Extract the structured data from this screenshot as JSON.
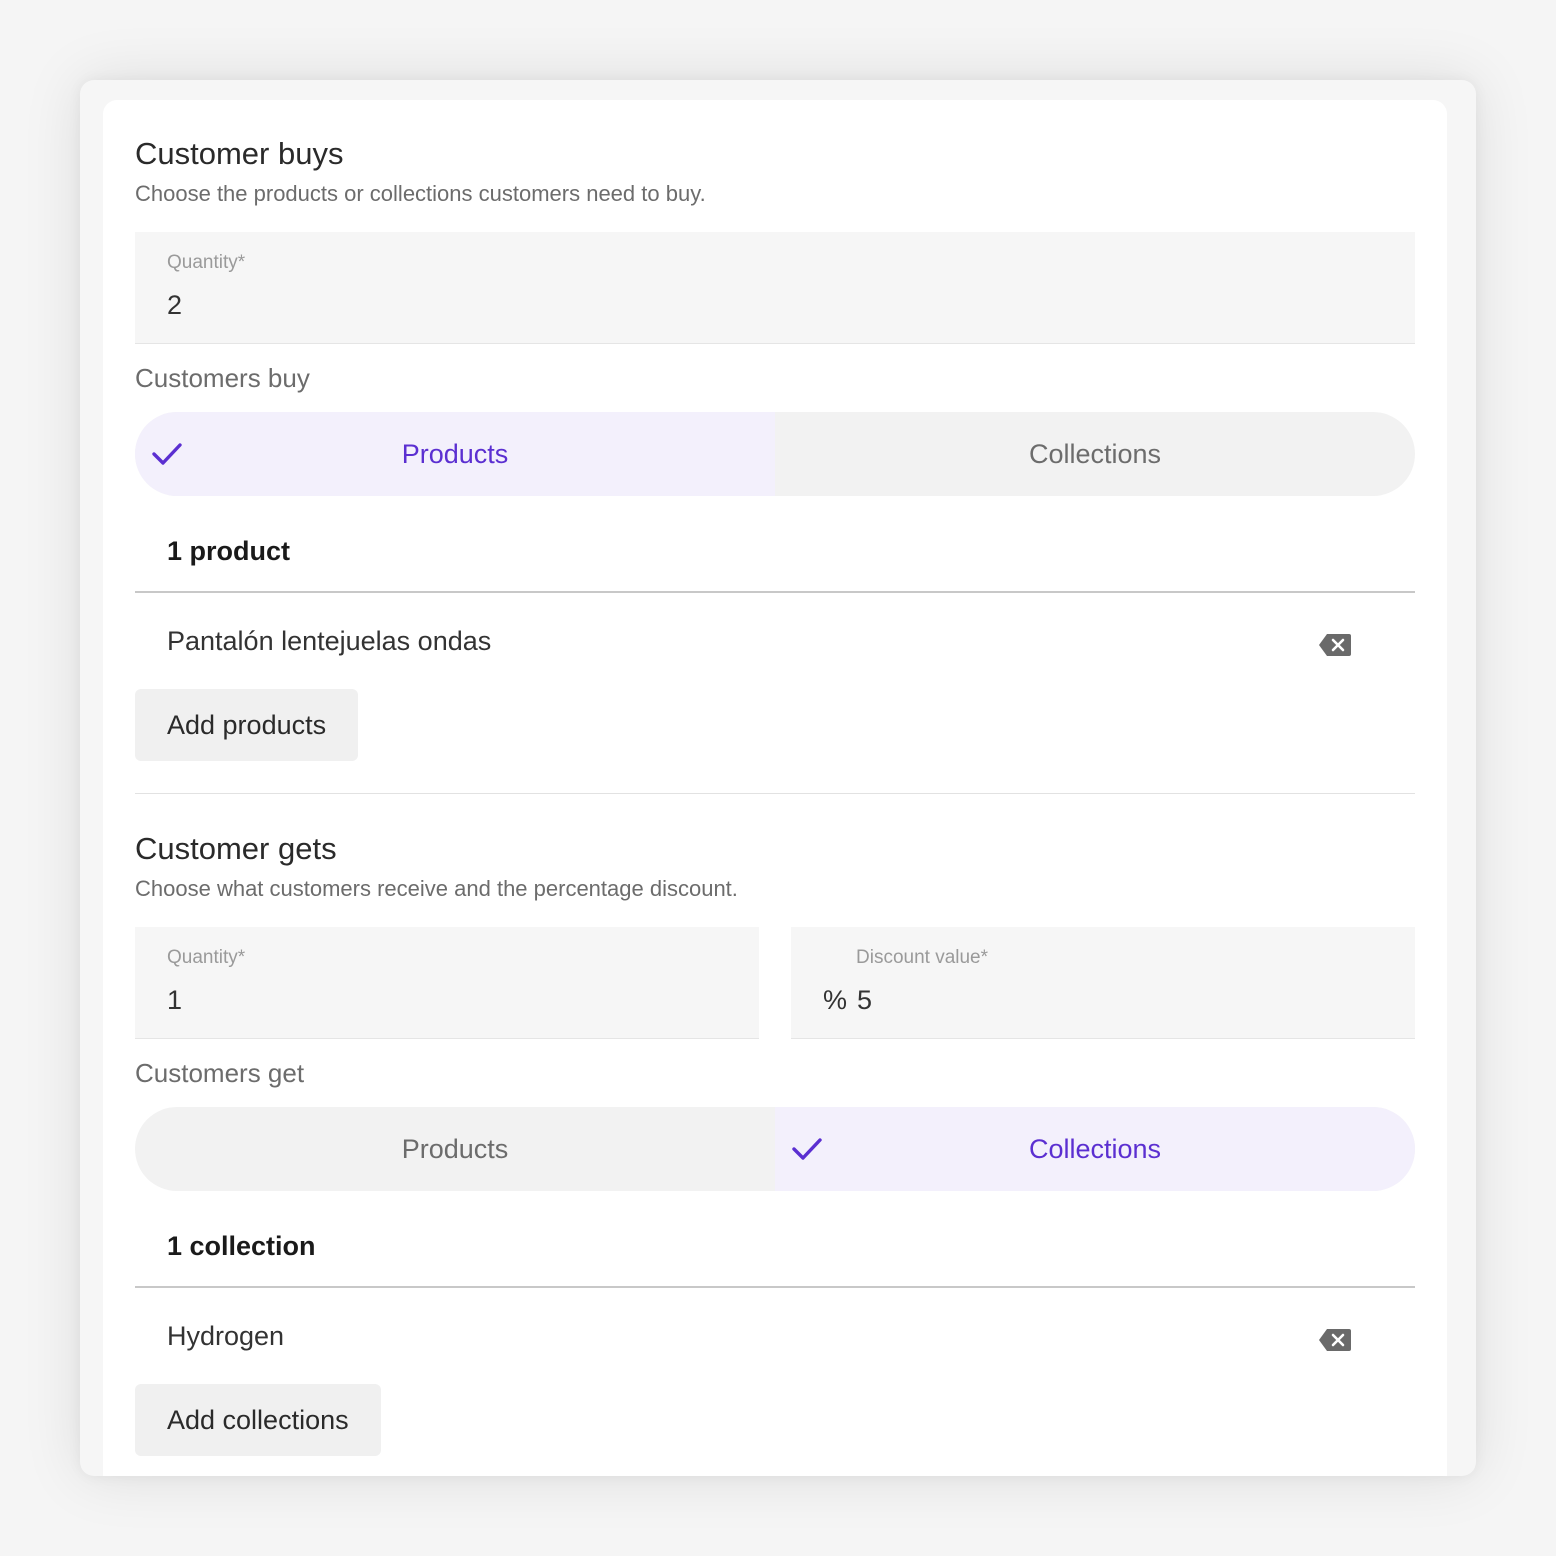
{
  "buys": {
    "title": "Customer buys",
    "subtitle": "Choose the products or collections customers need to buy.",
    "quantity": {
      "label": "Quantity*",
      "value": "2"
    },
    "section_label": "Customers buy",
    "toggle": {
      "options": [
        "Products",
        "Collections"
      ],
      "selected": "Products"
    },
    "count_label": "1 product",
    "items": [
      "Pantalón lentejuelas ondas"
    ],
    "add_button": "Add products"
  },
  "gets": {
    "title": "Customer gets",
    "subtitle": "Choose what customers receive and the percentage discount.",
    "quantity": {
      "label": "Quantity*",
      "value": "1"
    },
    "discount": {
      "label": "Discount value*",
      "prefix": "%",
      "value": "5"
    },
    "section_label": "Customers get",
    "toggle": {
      "options": [
        "Products",
        "Collections"
      ],
      "selected": "Collections"
    },
    "count_label": "1 collection",
    "items": [
      "Hydrogen"
    ],
    "add_button": "Add collections"
  },
  "icons": {
    "check": "check-icon",
    "remove": "backspace-delete-icon"
  },
  "colors": {
    "accent": "#5b2fd1",
    "accent_bg": "#f3f0fc",
    "toggle_bg": "#f2f2f2"
  }
}
